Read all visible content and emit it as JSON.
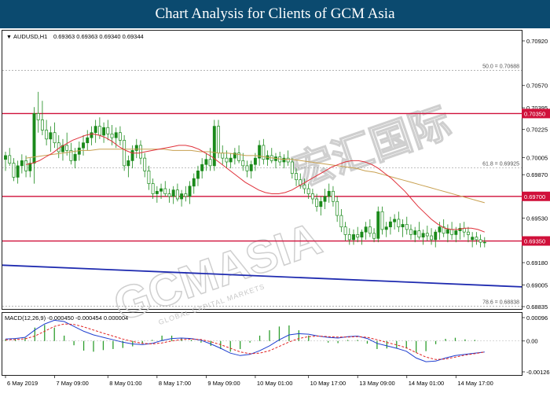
{
  "banner_title": "Chart Analysis for Clients of GCM Asia",
  "watermark": {
    "main": "GCMASIA",
    "chinese": "宏汇国际",
    "sub": "GLOBAL CAPITAL MARKETS"
  },
  "colors": {
    "banner": "#0b4a6f",
    "candle": "#1a8a1a",
    "level_line": "#d0103a",
    "trend_line": "#1f2bb0",
    "ma_fast": "#e0303a",
    "ma_slow": "#c8a050",
    "macd_main": "#1f3fd0",
    "macd_signal": "#e02020",
    "macd_hist": "#2e9e2e"
  },
  "chart_data": [
    {
      "type": "candlestick",
      "symbol_label": "AUDUSD,H1",
      "ohlc_label": "0.69363 0.69363 0.69340 0.69344",
      "ylim": [
        0.68835,
        0.7092
      ],
      "y_ticks": [
        "0.70920",
        "0.70570",
        "0.70395",
        "0.70225",
        "0.70005",
        "0.69870",
        "0.69530",
        "0.69180",
        "0.69005",
        "0.68835"
      ],
      "x_labels": [
        "6 May 2019",
        "7 May 09:00",
        "8 May 01:00",
        "8 May 17:00",
        "9 May 09:00",
        "10 May 01:00",
        "10 May 17:00",
        "13 May 09:00",
        "14 May 01:00",
        "14 May 17:00"
      ],
      "x_label_positions": [
        0,
        11,
        21,
        31,
        41,
        51,
        61,
        71,
        81,
        91
      ],
      "levels": [
        {
          "value": 0.7035,
          "label": "0.70350"
        },
        {
          "value": 0.697,
          "label": "0.69700"
        },
        {
          "value": 0.6935,
          "label": "0.69350"
        }
      ],
      "fib_levels": [
        {
          "value": 0.70688,
          "label": "50.0 = 0.70688"
        },
        {
          "value": 0.69925,
          "label": "61.8 = 0.69925"
        },
        {
          "value": 0.68838,
          "label": "78.6 = 0.68838"
        }
      ],
      "trendline": {
        "start_bar": 0,
        "start_value": 0.6916,
        "end_bar": 125,
        "end_value": 0.6899
      },
      "candles": [
        [
          0.6999,
          0.7005,
          0.699,
          0.7002
        ],
        [
          0.7002,
          0.7008,
          0.6994,
          0.6996
        ],
        [
          0.6996,
          0.7,
          0.6982,
          0.6985
        ],
        [
          0.6985,
          0.6998,
          0.698,
          0.6994
        ],
        [
          0.6994,
          0.7003,
          0.6988,
          0.6998
        ],
        [
          0.6998,
          0.7002,
          0.6985,
          0.699
        ],
        [
          0.699,
          0.7,
          0.6985,
          0.6996
        ],
        [
          0.6996,
          0.704,
          0.698,
          0.7035
        ],
        [
          0.7035,
          0.7052,
          0.702,
          0.703
        ],
        [
          0.703,
          0.7045,
          0.7018,
          0.7022
        ],
        [
          0.7022,
          0.703,
          0.701,
          0.7015
        ],
        [
          0.7015,
          0.7025,
          0.7005,
          0.702
        ],
        [
          0.702,
          0.7028,
          0.7008,
          0.7012
        ],
        [
          0.7012,
          0.7018,
          0.7,
          0.7005
        ],
        [
          0.7005,
          0.7015,
          0.6998,
          0.701
        ],
        [
          0.701,
          0.702,
          0.7002,
          0.7006
        ],
        [
          0.7006,
          0.7012,
          0.6995,
          0.6998
        ],
        [
          0.6998,
          0.7008,
          0.6992,
          0.7003
        ],
        [
          0.7003,
          0.7013,
          0.6998,
          0.7008
        ],
        [
          0.7008,
          0.7018,
          0.7002,
          0.7012
        ],
        [
          0.7012,
          0.7022,
          0.7006,
          0.7016
        ],
        [
          0.7016,
          0.7025,
          0.701,
          0.702
        ],
        [
          0.702,
          0.703,
          0.7012,
          0.7025
        ],
        [
          0.7025,
          0.7032,
          0.7015,
          0.7018
        ],
        [
          0.7018,
          0.7028,
          0.7012,
          0.7024
        ],
        [
          0.7024,
          0.703,
          0.7014,
          0.7019
        ],
        [
          0.7019,
          0.7026,
          0.701,
          0.7016
        ],
        [
          0.7016,
          0.7024,
          0.7008,
          0.702
        ],
        [
          0.702,
          0.7025,
          0.701,
          0.7014
        ],
        [
          0.7014,
          0.7018,
          0.699,
          0.6994
        ],
        [
          0.6994,
          0.7002,
          0.6985,
          0.6998
        ],
        [
          0.6998,
          0.701,
          0.6992,
          0.7006
        ],
        [
          0.7006,
          0.7015,
          0.7,
          0.701
        ],
        [
          0.701,
          0.7014,
          0.6995,
          0.7
        ],
        [
          0.7,
          0.7004,
          0.6985,
          0.699
        ],
        [
          0.699,
          0.6994,
          0.6975,
          0.698
        ],
        [
          0.698,
          0.6984,
          0.6968,
          0.6972
        ],
        [
          0.6972,
          0.6978,
          0.6965,
          0.6974
        ],
        [
          0.6974,
          0.698,
          0.6968,
          0.6976
        ],
        [
          0.6976,
          0.6982,
          0.697,
          0.6972
        ],
        [
          0.6972,
          0.6976,
          0.6965,
          0.697
        ],
        [
          0.697,
          0.6978,
          0.6964,
          0.6975
        ],
        [
          0.6975,
          0.698,
          0.6966,
          0.6968
        ],
        [
          0.6968,
          0.6975,
          0.6962,
          0.6972
        ],
        [
          0.6972,
          0.6978,
          0.6966,
          0.697
        ],
        [
          0.697,
          0.6982,
          0.6964,
          0.6978
        ],
        [
          0.6978,
          0.6988,
          0.6972,
          0.6984
        ],
        [
          0.6984,
          0.6994,
          0.6978,
          0.699
        ],
        [
          0.699,
          0.7,
          0.6984,
          0.6995
        ],
        [
          0.6995,
          0.7004,
          0.699,
          0.6999
        ],
        [
          0.6999,
          0.7008,
          0.699,
          0.6994
        ],
        [
          0.6994,
          0.703,
          0.699,
          0.7025
        ],
        [
          0.7025,
          0.703,
          0.7,
          0.7004
        ],
        [
          0.7004,
          0.701,
          0.6995,
          0.7
        ],
        [
          0.7,
          0.7006,
          0.6992,
          0.6997
        ],
        [
          0.6997,
          0.7004,
          0.6992,
          0.7
        ],
        [
          0.7,
          0.7008,
          0.6995,
          0.7004
        ],
        [
          0.7004,
          0.701,
          0.6996,
          0.6998
        ],
        [
          0.6998,
          0.7004,
          0.699,
          0.6994
        ],
        [
          0.6994,
          0.6998,
          0.6985,
          0.699
        ],
        [
          0.699,
          0.6998,
          0.6984,
          0.6995
        ],
        [
          0.6995,
          0.7004,
          0.699,
          0.7
        ],
        [
          0.7,
          0.7014,
          0.6994,
          0.701
        ],
        [
          0.701,
          0.7015,
          0.6995,
          0.6999
        ],
        [
          0.6999,
          0.7006,
          0.6994,
          0.7002
        ],
        [
          0.7002,
          0.7008,
          0.6996,
          0.6998
        ],
        [
          0.6998,
          0.7004,
          0.6992,
          0.7001
        ],
        [
          0.7001,
          0.7005,
          0.6994,
          0.6997
        ],
        [
          0.6997,
          0.7003,
          0.6992,
          0.7
        ],
        [
          0.7,
          0.7006,
          0.6994,
          0.6997
        ],
        [
          0.6997,
          0.7,
          0.6984,
          0.6988
        ],
        [
          0.6988,
          0.6992,
          0.6978,
          0.6983
        ],
        [
          0.6983,
          0.6988,
          0.6976,
          0.6979
        ],
        [
          0.6979,
          0.6984,
          0.6972,
          0.6976
        ],
        [
          0.6976,
          0.698,
          0.6968,
          0.6972
        ],
        [
          0.6972,
          0.6976,
          0.6964,
          0.6968
        ],
        [
          0.6968,
          0.6972,
          0.6958,
          0.6962
        ],
        [
          0.6962,
          0.697,
          0.6955,
          0.6966
        ],
        [
          0.6966,
          0.6976,
          0.696,
          0.697
        ],
        [
          0.697,
          0.698,
          0.6965,
          0.6974
        ],
        [
          0.6974,
          0.6978,
          0.6962,
          0.6966
        ],
        [
          0.6966,
          0.697,
          0.695,
          0.6955
        ],
        [
          0.6955,
          0.696,
          0.6942,
          0.6946
        ],
        [
          0.6946,
          0.695,
          0.6935,
          0.694
        ],
        [
          0.694,
          0.6945,
          0.6932,
          0.6936
        ],
        [
          0.6936,
          0.6944,
          0.6932,
          0.694
        ],
        [
          0.694,
          0.6946,
          0.6934,
          0.6938
        ],
        [
          0.6938,
          0.6944,
          0.6932,
          0.6942
        ],
        [
          0.6942,
          0.695,
          0.6936,
          0.6946
        ],
        [
          0.6946,
          0.6952,
          0.6938,
          0.6941
        ],
        [
          0.6941,
          0.6945,
          0.6934,
          0.6937
        ],
        [
          0.6937,
          0.6962,
          0.6934,
          0.6958
        ],
        [
          0.6958,
          0.6962,
          0.694,
          0.6944
        ],
        [
          0.6944,
          0.695,
          0.6938,
          0.6946
        ],
        [
          0.6946,
          0.6954,
          0.694,
          0.695
        ],
        [
          0.695,
          0.6956,
          0.6944,
          0.6952
        ],
        [
          0.6952,
          0.6958,
          0.6942,
          0.6946
        ],
        [
          0.6946,
          0.6952,
          0.6938,
          0.6948
        ],
        [
          0.6948,
          0.6954,
          0.694,
          0.6944
        ],
        [
          0.6944,
          0.6948,
          0.6936,
          0.694
        ],
        [
          0.694,
          0.6946,
          0.6934,
          0.6943
        ],
        [
          0.6943,
          0.695,
          0.6936,
          0.6938
        ],
        [
          0.6938,
          0.6944,
          0.6932,
          0.6941
        ],
        [
          0.6941,
          0.6947,
          0.6935,
          0.6939
        ],
        [
          0.6939,
          0.6945,
          0.6932,
          0.6936
        ],
        [
          0.6936,
          0.6944,
          0.693,
          0.6942
        ],
        [
          0.6942,
          0.695,
          0.6936,
          0.6946
        ],
        [
          0.6946,
          0.6952,
          0.6938,
          0.6941
        ],
        [
          0.6941,
          0.6948,
          0.6934,
          0.6944
        ],
        [
          0.6944,
          0.695,
          0.6936,
          0.694
        ],
        [
          0.694,
          0.6946,
          0.6934,
          0.6943
        ],
        [
          0.6943,
          0.6949,
          0.6936,
          0.6945
        ],
        [
          0.6945,
          0.695,
          0.6938,
          0.6942
        ],
        [
          0.6942,
          0.6946,
          0.6934,
          0.694
        ],
        [
          0.6936,
          0.6942,
          0.693,
          0.6938
        ],
        [
          0.6938,
          0.6942,
          0.6932,
          0.6936
        ],
        [
          0.6936,
          0.694,
          0.693,
          0.6934
        ],
        [
          0.6934,
          0.6938,
          0.693,
          0.6934
        ]
      ],
      "ma_fast": [
        0.6995,
        0.6996,
        0.6998,
        0.7001,
        0.7004,
        0.7008,
        0.7011,
        0.7014,
        0.7016,
        0.7018,
        0.7019,
        0.7018,
        0.7016,
        0.7013,
        0.7009,
        0.7006,
        0.7004,
        0.7004,
        0.7005,
        0.7006,
        0.7007,
        0.7008,
        0.7009,
        0.701,
        0.701,
        0.7009,
        0.7007,
        0.7004,
        0.7001,
        0.6997,
        0.6993,
        0.6989,
        0.6985,
        0.6981,
        0.6978,
        0.6975,
        0.6973,
        0.6972,
        0.6972,
        0.6973,
        0.6975,
        0.6978,
        0.6981,
        0.6984,
        0.6987,
        0.699,
        0.6993,
        0.6995,
        0.6997,
        0.6998,
        0.6998,
        0.6997,
        0.6995,
        0.6992,
        0.6988,
        0.6984,
        0.6979,
        0.6974,
        0.6968,
        0.6962,
        0.6957,
        0.6952,
        0.6948,
        0.6945,
        0.6944,
        0.6944,
        0.6945,
        0.6945,
        0.6944,
        0.6942
      ],
      "ma_fast_start": 5,
      "ma_slow": [
        0.7,
        0.7001,
        0.7002,
        0.7003,
        0.7004,
        0.7005,
        0.7006,
        0.7006,
        0.7007,
        0.7007,
        0.7007,
        0.7007,
        0.7007,
        0.7007,
        0.7007,
        0.7007,
        0.7006,
        0.7006,
        0.7006,
        0.7005,
        0.7005,
        0.7004,
        0.7004,
        0.7003,
        0.7002,
        0.7002,
        0.7001,
        0.7,
        0.6999,
        0.6999,
        0.6998,
        0.6997,
        0.6996,
        0.6995,
        0.6994,
        0.6993,
        0.6992,
        0.699,
        0.6989,
        0.6987,
        0.6985,
        0.6983,
        0.6981,
        0.6979,
        0.6977,
        0.6975,
        0.6973,
        0.6971,
        0.6969,
        0.6967,
        0.6965
      ],
      "ma_slow_start": 5
    },
    {
      "type": "line",
      "label": "MACD(12,26,9) -0.000450 -0.000454 0.000004",
      "ylim": [
        -0.001267,
        0.00096
      ],
      "y_ticks": [
        "0.00096",
        "0.00",
        "-0.001267"
      ],
      "series": [
        {
          "name": "MACD",
          "values": [
            8e-05,
            0.0001,
            0.00015,
            0.00045,
            0.0007,
            0.00085,
            0.0008,
            0.0006,
            0.0004,
            0.00025,
            0.00015,
            5e-05,
            -5e-05,
            -0.00012,
            -0.00015,
            -0.0001,
            2e-05,
            0.0001,
            0.00012,
            0.0001,
            3e-05,
            -0.00012,
            -0.0003,
            -0.0005,
            -0.0006,
            -0.00055,
            -0.0004,
            -0.0002,
            5e-05,
            0.00025,
            0.0003,
            0.00028,
            0.0002,
            0.00015,
            0.00012,
            0.00018,
            0.0002,
            0.0001,
            -0.0001,
            -0.0002,
            -0.0003,
            -0.00042,
            -0.0007,
            -0.00085,
            -0.00082,
            -0.0007,
            -0.0006,
            -0.00055,
            -0.0005,
            -0.00045
          ]
        },
        {
          "name": "Signal",
          "values": [
            5e-05,
            6e-05,
            9e-05,
            0.0002,
            0.0004,
            0.0006,
            0.0007,
            0.00068,
            0.00058,
            0.00045,
            0.00032,
            0.0002,
            8e-05,
            -2e-05,
            -0.0001,
            -0.00012,
            -8e-05,
            0.0,
            6e-05,
            8e-05,
            6e-05,
            -3e-05,
            -0.00015,
            -0.0003,
            -0.00045,
            -0.00052,
            -0.0005,
            -0.0004,
            -0.00022,
            -4e-05,
            0.0001,
            0.00018,
            0.0002,
            0.00018,
            0.00016,
            0.00016,
            0.00018,
            0.00015,
            5e-05,
            -6e-05,
            -0.00016,
            -0.00028,
            -0.00048,
            -0.00066,
            -0.00076,
            -0.00074,
            -0.00066,
            -0.00058,
            -0.00052,
            -0.00045
          ]
        }
      ]
    }
  ]
}
